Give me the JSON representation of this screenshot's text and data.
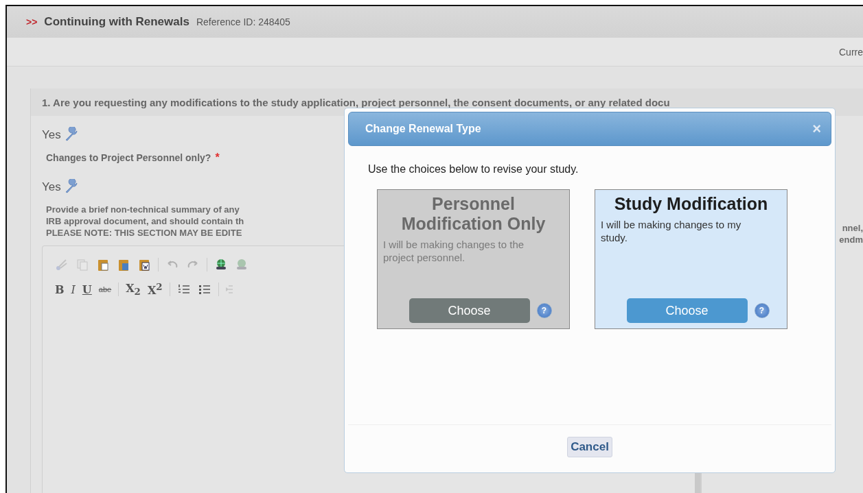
{
  "header": {
    "marker": ">>",
    "title": "Continuing with Renewals",
    "reference": "Reference ID: 248405"
  },
  "subbar": {
    "right_text": "Curre"
  },
  "question": {
    "title": "1.  Are you requesting any modifications to the study application, project personnel, the consent documents, or any related docu",
    "answer1": "Yes",
    "sub_question": "Changes to Project Personnel only?",
    "required": true,
    "required_mark": "*",
    "answer2": "Yes",
    "instructions": [
      "Provide a brief non-technical summary of any",
      "IRB approval document, and should contain th",
      "PLEASE NOTE: THIS SECTION MAY BE EDITE"
    ],
    "instructions_right": [
      "nnel,",
      "endm"
    ]
  },
  "editor": {
    "toolbar1": [
      {
        "kind": "cut",
        "disabled": true
      },
      {
        "kind": "copy",
        "disabled": true
      },
      {
        "kind": "paste",
        "disabled": false
      },
      {
        "kind": "paste-text",
        "disabled": false
      },
      {
        "kind": "paste-word",
        "disabled": false
      },
      {
        "kind": "sep"
      },
      {
        "kind": "undo",
        "disabled": true
      },
      {
        "kind": "redo",
        "disabled": true
      },
      {
        "kind": "sep"
      },
      {
        "kind": "link",
        "disabled": false
      },
      {
        "kind": "unlink",
        "disabled": true
      }
    ],
    "toolbar2": [
      {
        "kind": "bold",
        "label": "B"
      },
      {
        "kind": "italic",
        "label": "I"
      },
      {
        "kind": "underline",
        "label": "U"
      },
      {
        "kind": "strike",
        "label": "abe"
      },
      {
        "kind": "sep"
      },
      {
        "kind": "subscript",
        "label": "X$_{2}$"
      },
      {
        "kind": "superscript",
        "label": "X$^{2}$"
      },
      {
        "kind": "sep"
      },
      {
        "kind": "numbered-list"
      },
      {
        "kind": "bullet-list"
      },
      {
        "kind": "sep"
      },
      {
        "kind": "outdent"
      }
    ]
  },
  "dialog": {
    "title": "Change Renewal Type",
    "close": "×",
    "intro": "Use the choices below to revise your study.",
    "options": [
      {
        "title": "Personnel Modification Only",
        "description": "I will be making changes to the project personnel.",
        "button": "Choose",
        "help": "?",
        "selected": false
      },
      {
        "title": "Study Modification",
        "description": "I will be making changes to my study.",
        "button": "Choose",
        "help": "?",
        "selected": true
      }
    ],
    "cancel": "Cancel"
  }
}
